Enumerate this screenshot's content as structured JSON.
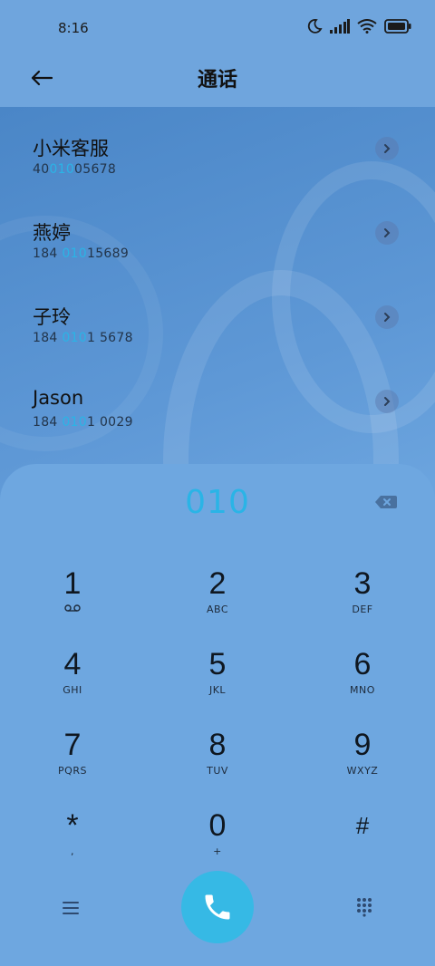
{
  "status_bar": {
    "time": "8:16",
    "icons": [
      "moon-icon",
      "signal-icon",
      "wifi-icon",
      "battery-icon"
    ]
  },
  "header": {
    "title": "通话",
    "back_icon": "back-arrow-icon"
  },
  "results": [
    {
      "name": "小米客服",
      "number_pre": "40",
      "number_match": "010",
      "number_post": "05678"
    },
    {
      "name": "燕婷",
      "number_pre": "184 ",
      "number_match": "010",
      "number_post": "15689"
    },
    {
      "name": "子玲",
      "number_pre": "184 ",
      "number_match": "010",
      "number_post": "1 5678"
    },
    {
      "name": "Jason",
      "number_pre": "184 ",
      "number_match": "010",
      "number_post": "1 0029"
    }
  ],
  "dialpad": {
    "input_value": "010",
    "keys": [
      {
        "digit": "1",
        "letters": ""
      },
      {
        "digit": "2",
        "letters": "ABC"
      },
      {
        "digit": "3",
        "letters": "DEF"
      },
      {
        "digit": "4",
        "letters": "GHI"
      },
      {
        "digit": "5",
        "letters": "JKL"
      },
      {
        "digit": "6",
        "letters": "MNO"
      },
      {
        "digit": "7",
        "letters": "PQRS"
      },
      {
        "digit": "8",
        "letters": "TUV"
      },
      {
        "digit": "9",
        "letters": "WXYZ"
      },
      {
        "digit": "*",
        "letters": ","
      },
      {
        "digit": "0",
        "letters": "+"
      },
      {
        "digit": "#",
        "letters": ""
      }
    ]
  },
  "colors": {
    "accent": "#2ab4e6",
    "call_button": "#36b9e5",
    "background": "#6fa5dd"
  }
}
